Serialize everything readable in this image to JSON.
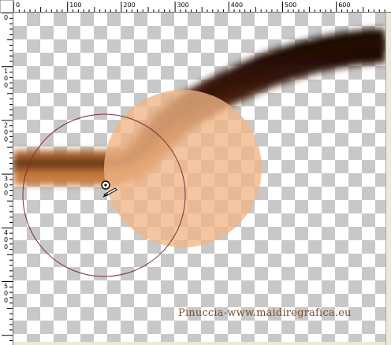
{
  "rulers": {
    "top_labels": [
      "0",
      "100",
      "200",
      "300",
      "400",
      "500",
      "600"
    ],
    "left_labels": [
      "0",
      "100",
      "200",
      "300",
      "400",
      "500"
    ]
  },
  "canvas": {
    "background": "transparency-checkerboard",
    "stroke_colors": [
      "#1f0c05",
      "#5a2a10",
      "#a4591f",
      "#c77a3c"
    ],
    "selection_fill": "#f0b587"
  },
  "tool": {
    "brush_outline_icon": "brush-outline-circle-icon",
    "cursor_icon": "clone-brush-cursor-icon"
  },
  "watermark": {
    "text": "Pinuccia-www.maidiregrafica.eu",
    "color": "#7a4a24"
  }
}
